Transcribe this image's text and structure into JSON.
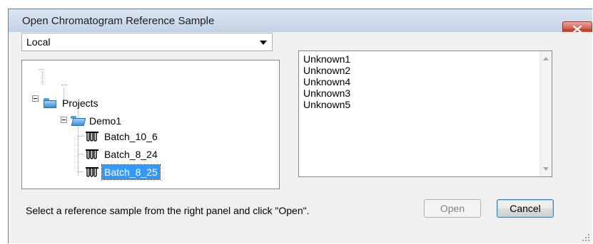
{
  "window": {
    "title": "Open Chromatogram Reference Sample",
    "close_icon": "close-x-icon"
  },
  "source": {
    "selected": "Local",
    "options_visible": [
      "Local"
    ]
  },
  "tree": {
    "root": {
      "label": "Projects",
      "icon": "folder-icon",
      "expanded": true
    },
    "project": {
      "label": "Demo1",
      "icon": "open-folder-icon",
      "expanded": true
    },
    "batches": [
      {
        "label": "Batch_10_6",
        "icon": "sample-tubes-icon",
        "selected": false
      },
      {
        "label": "Batch_8_24",
        "icon": "sample-tubes-icon",
        "selected": false
      },
      {
        "label": "Batch_8_25",
        "icon": "sample-tubes-icon",
        "selected": true
      }
    ]
  },
  "samples": [
    "Unknown1",
    "Unknown2",
    "Unknown4",
    "Unknown3",
    "Unknown5"
  ],
  "footer": {
    "hint": "Select a reference sample from the right panel and click \"Open\".",
    "open_label": "Open",
    "cancel_label": "Cancel"
  },
  "colors": {
    "selection": "#3399ff",
    "close_button": "#c23d2a"
  }
}
